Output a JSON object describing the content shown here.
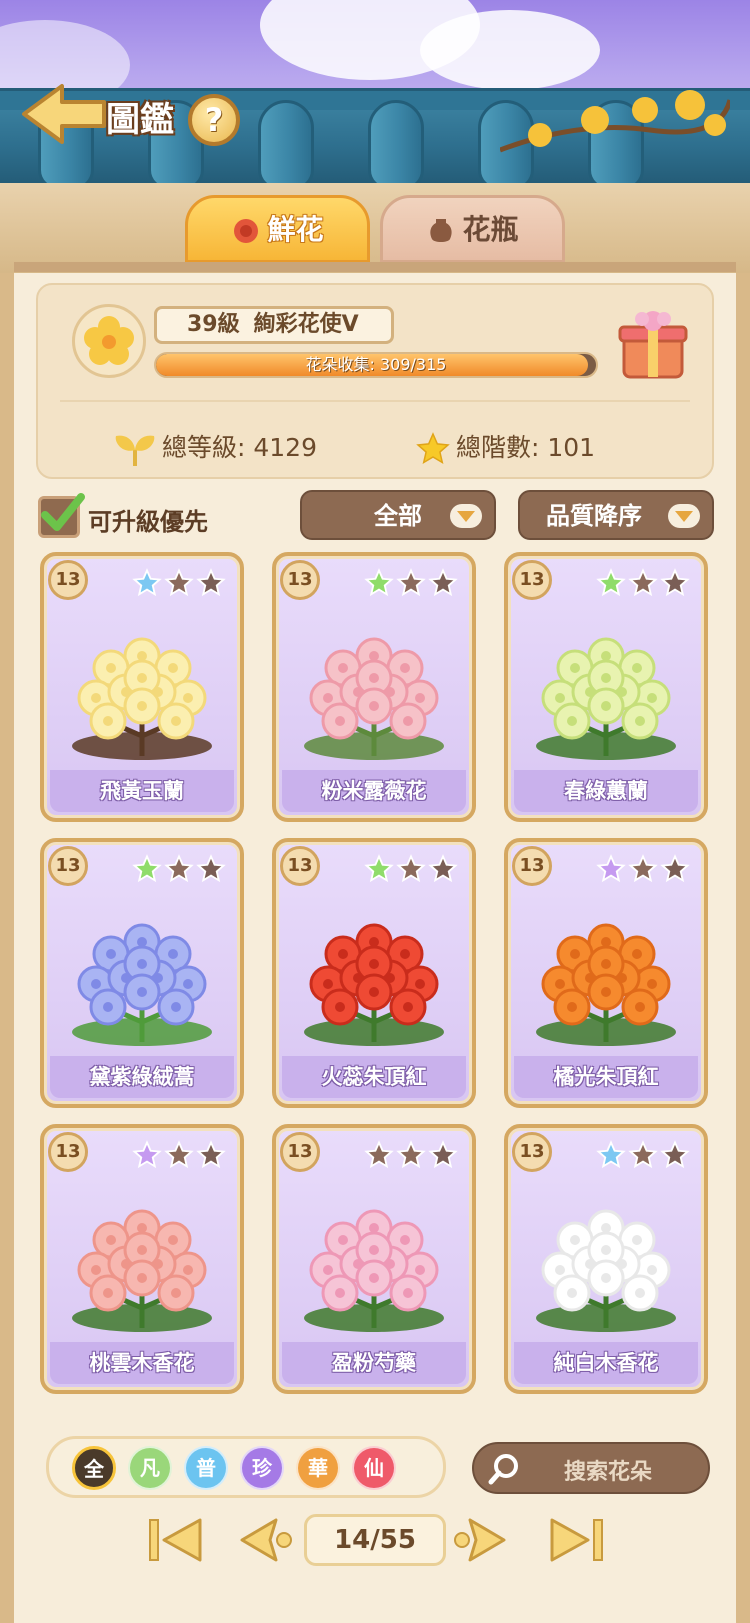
{
  "header": {
    "title": "圖鑑",
    "help": "?"
  },
  "tabs": [
    {
      "label": "鮮花",
      "active": true
    },
    {
      "label": "花瓶",
      "active": false
    }
  ],
  "profile": {
    "level": "39級",
    "rank": "絢彩花使V",
    "collection_text": "花朵收集: 309/315",
    "collection_current": 309,
    "collection_total": 315,
    "total_level_text": "總等級: 4129",
    "total_stage_text": "總階數: 101"
  },
  "filters": {
    "upgrade_first_label": "可升級優先",
    "upgrade_first_checked": true,
    "category": "全部",
    "sort": "品質降序"
  },
  "cards": [
    {
      "level": "13",
      "name": "飛黃玉蘭",
      "star_color": "#7cc8f2",
      "art": "magnolia"
    },
    {
      "level": "13",
      "name": "粉米露薇花",
      "star_color": "#8fdc6a",
      "art": "pink-cluster"
    },
    {
      "level": "13",
      "name": "春綠蕙蘭",
      "star_color": "#8fdc6a",
      "art": "orchid"
    },
    {
      "level": "13",
      "name": "黛紫綠絨蒿",
      "star_color": "#8fdc6a",
      "art": "poppy"
    },
    {
      "level": "13",
      "name": "火蕊朱頂紅",
      "star_color": "#8fdc6a",
      "art": "red-amaryllis"
    },
    {
      "level": "13",
      "name": "橘光朱頂紅",
      "star_color": "#c59af0",
      "art": "orange-amaryllis"
    },
    {
      "level": "13",
      "name": "桃雲木香花",
      "star_color": "#c59af0",
      "art": "pink-rose"
    },
    {
      "level": "13",
      "name": "盈粉芍藥",
      "star_color": "#8b6a5c",
      "art": "peony"
    },
    {
      "level": "13",
      "name": "純白木香花",
      "star_color": "#7cc8f2",
      "art": "white-rose"
    }
  ],
  "rarity_filters": [
    {
      "label": "全",
      "color": "#4a3a2a"
    },
    {
      "label": "凡",
      "color": "#9ad77a"
    },
    {
      "label": "普",
      "color": "#6cc4f0"
    },
    {
      "label": "珍",
      "color": "#a57ae6"
    },
    {
      "label": "華",
      "color": "#f0a040"
    },
    {
      "label": "仙",
      "color": "#ef5a6a"
    }
  ],
  "search": {
    "placeholder": "搜索花朵"
  },
  "pagination": {
    "text": "14/55"
  }
}
